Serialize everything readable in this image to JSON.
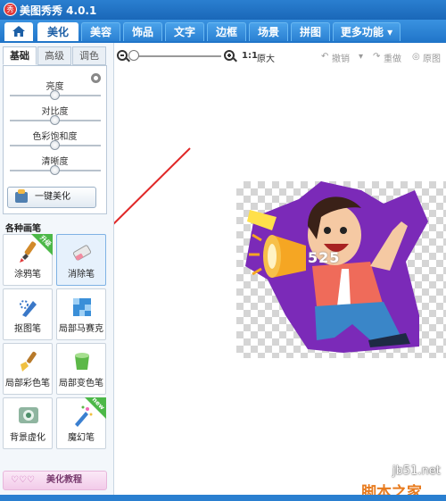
{
  "app": {
    "title": "美图秀秀 4.0.1",
    "logo_glyph": "秀"
  },
  "tabs": {
    "home_icon": "home-icon",
    "items": [
      {
        "label": "美化",
        "active": true
      },
      {
        "label": "美容"
      },
      {
        "label": "饰品"
      },
      {
        "label": "文字"
      },
      {
        "label": "边框"
      },
      {
        "label": "场景"
      },
      {
        "label": "拼图"
      },
      {
        "label": "更多功能 ▾"
      }
    ]
  },
  "panel": {
    "subtabs": [
      {
        "label": "基础",
        "active": true
      },
      {
        "label": "高级"
      },
      {
        "label": "调色"
      }
    ],
    "sliders": [
      {
        "label": "亮度",
        "value": 0.5
      },
      {
        "label": "对比度",
        "value": 0.5
      },
      {
        "label": "色彩饱和度",
        "value": 0.5
      },
      {
        "label": "清晰度",
        "value": 0.5
      }
    ],
    "one_click_label": "一键美化",
    "section_title": "各种画笔",
    "brushes": [
      {
        "label": "涂鸦笔",
        "icon": "graffiti-pen-icon",
        "badge": "升级"
      },
      {
        "label": "消除笔",
        "icon": "eraser-icon",
        "selected": true
      },
      {
        "label": "抠图笔",
        "icon": "cutout-pen-icon"
      },
      {
        "label": "局部马赛克",
        "icon": "mosaic-icon"
      },
      {
        "label": "局部彩色笔",
        "icon": "color-brush-icon"
      },
      {
        "label": "局部变色笔",
        "icon": "recolor-brush-icon"
      },
      {
        "label": "背景虚化",
        "icon": "background-blur-icon"
      },
      {
        "label": "魔幻笔",
        "icon": "magic-pen-icon",
        "badge": "new"
      }
    ],
    "tutorial_label": "美化教程"
  },
  "toolbar": {
    "ratio_label": "1:1",
    "original_size_label": "原大",
    "undo_label": "撤销",
    "redo_label": "重做",
    "original_image_label": "原图"
  },
  "canvas": {
    "overlay_number": "525"
  },
  "watermark": {
    "site": "jb51.net",
    "brand": "脚本之家"
  },
  "colors": {
    "accent": "#1f74c8",
    "tab_active_text": "#1c5fa6",
    "annotation_arrow": "#e02828",
    "character_outline": "#8a2bc2"
  }
}
